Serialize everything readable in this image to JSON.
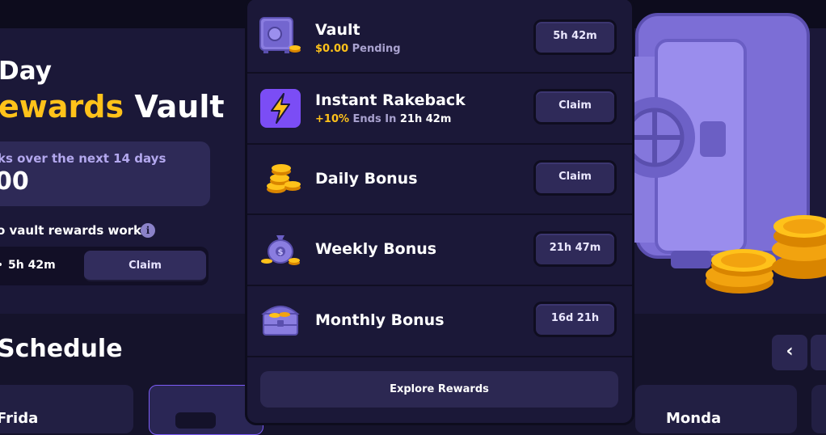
{
  "hero": {
    "line1": "Day",
    "line2_gold": "ewards",
    "line2_white": " Vault"
  },
  "summary": {
    "text": "ks over the next 14 days",
    "amount": "00"
  },
  "how": {
    "text": "o vault rewards work?",
    "info_glyph": "i"
  },
  "timer": {
    "value": "5h 42m",
    "claim_label": "Claim"
  },
  "schedule": {
    "title": "Schedule",
    "prev_glyph": "‹",
    "cards": [
      {
        "label": "Frida"
      },
      {
        "label": ""
      },
      {
        "label": "Monda"
      }
    ]
  },
  "dropdown": {
    "rows": [
      {
        "title": "Vault",
        "sub_gold": "$0.00",
        "sub_rest": " Pending",
        "sub_white": "",
        "button": "5h 42m",
        "icon": "safe-icon"
      },
      {
        "title": "Instant Rakeback",
        "sub_gold": "+10%",
        "sub_rest": " Ends In ",
        "sub_white": "21h 42m",
        "button": "Claim",
        "icon": "lightning-icon"
      },
      {
        "title": "Daily Bonus",
        "button": "Claim",
        "icon": "coin-stack-icon"
      },
      {
        "title": "Weekly Bonus",
        "button": "21h 47m",
        "icon": "money-bag-icon"
      },
      {
        "title": "Monthly Bonus",
        "button": "16d 21h",
        "icon": "treasure-chest-icon"
      }
    ],
    "explore_label": "Explore Rewards"
  },
  "colors": {
    "accent_gold": "#ffc21a",
    "accent_purple": "#7b5cf5",
    "panel_bg": "#1b1838"
  }
}
